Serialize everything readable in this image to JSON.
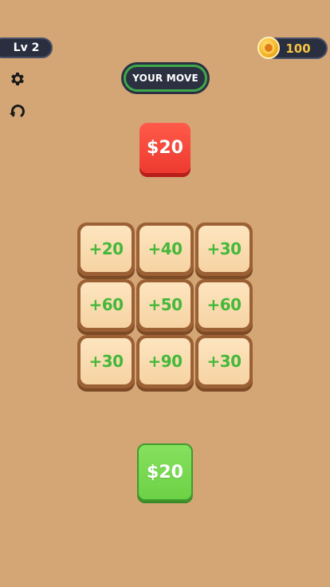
{
  "hud": {
    "level_label": "Lv 2",
    "coins": "100",
    "coin_icon": "coin-icon",
    "settings_icon": "gear-icon",
    "undo_icon": "undo-icon"
  },
  "turn_banner": {
    "label": "YOUR MOVE",
    "ring_color": "#3fa84a"
  },
  "opponent": {
    "amount": "$20",
    "color": "#ee3a30"
  },
  "board": {
    "tiles": [
      {
        "label": "+20"
      },
      {
        "label": "+40"
      },
      {
        "label": "+30"
      },
      {
        "label": "+60"
      },
      {
        "label": "+50"
      },
      {
        "label": "+60"
      },
      {
        "label": "+30"
      },
      {
        "label": "+90"
      },
      {
        "label": "+30"
      }
    ],
    "tile_text_color": "#45b83a"
  },
  "player": {
    "amount": "$20",
    "color": "#6cd245"
  }
}
